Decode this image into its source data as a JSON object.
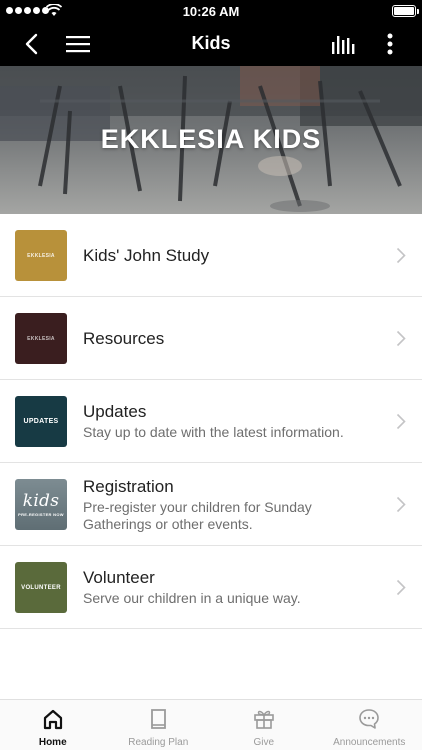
{
  "status_bar": {
    "time": "10:26 AM"
  },
  "nav": {
    "title": "Kids"
  },
  "hero": {
    "title": "EKKLESIA KIDS"
  },
  "list": [
    {
      "title": "Kids' John Study",
      "subtitle": "",
      "thumb_label": "EKKLESIA",
      "thumb_color": "#b8913a"
    },
    {
      "title": "Resources",
      "subtitle": "",
      "thumb_label": "EKKLESIA",
      "thumb_color": "#3a1e1f"
    },
    {
      "title": "Updates",
      "subtitle": "Stay up to date with the latest information.",
      "thumb_label": "UPDATES",
      "thumb_color": "#173a44"
    },
    {
      "title": "Registration",
      "subtitle": "Pre-register your children for Sunday Gatherings or other events.",
      "thumb_label": "kids",
      "thumb_sub": "PRE-REGISTER NOW",
      "thumb_color": "#6d7c82"
    },
    {
      "title": "Volunteer",
      "subtitle": "Serve our children in a unique way.",
      "thumb_label": "VOLUNTEER",
      "thumb_color": "#5a6a3b"
    }
  ],
  "tabs": [
    {
      "label": "Home",
      "icon": "home-icon",
      "active": true
    },
    {
      "label": "Reading Plan",
      "icon": "book-icon",
      "active": false
    },
    {
      "label": "Give",
      "icon": "gift-icon",
      "active": false
    },
    {
      "label": "Announcements",
      "icon": "chat-bubble-icon",
      "active": false
    }
  ]
}
